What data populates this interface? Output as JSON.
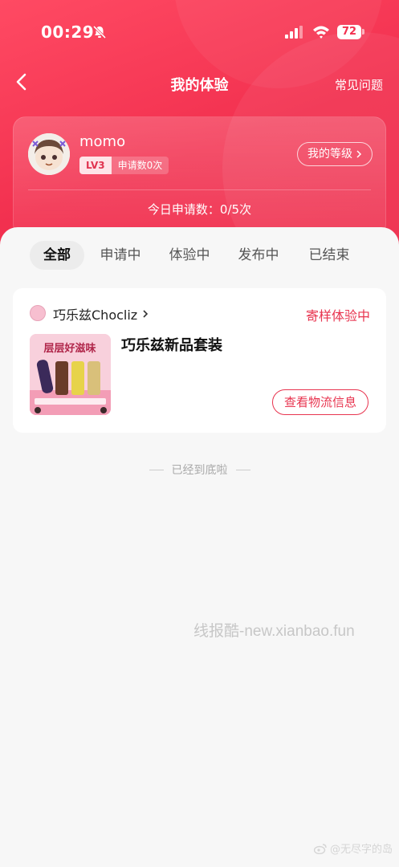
{
  "status_bar": {
    "time": "00:29",
    "battery": "72"
  },
  "nav": {
    "title": "我的体验",
    "faq": "常见问题"
  },
  "profile": {
    "username": "momo",
    "level": "LV3",
    "apply_count": "申请数0次",
    "grade_button": "我的等级",
    "today_apply": "今日申请数：0/5次"
  },
  "tabs": [
    {
      "label": "全部",
      "active": true
    },
    {
      "label": "申请中",
      "active": false
    },
    {
      "label": "体验中",
      "active": false
    },
    {
      "label": "发布中",
      "active": false
    },
    {
      "label": "已结束",
      "active": false
    }
  ],
  "order": {
    "shop_name": "巧乐兹Chocliz",
    "status": "寄样体验中",
    "product_name": "巧乐兹新品套装",
    "product_image_title": "层层好滋味",
    "logistics_button": "查看物流信息"
  },
  "end_text": "已经到底啦",
  "watermark": "线报酷-new.xianbao.fun",
  "weibo_mark": "@无尽字的岛",
  "colors": {
    "accent": "#e8344f",
    "hero": "#f2304f",
    "background": "#f7f7f7"
  }
}
